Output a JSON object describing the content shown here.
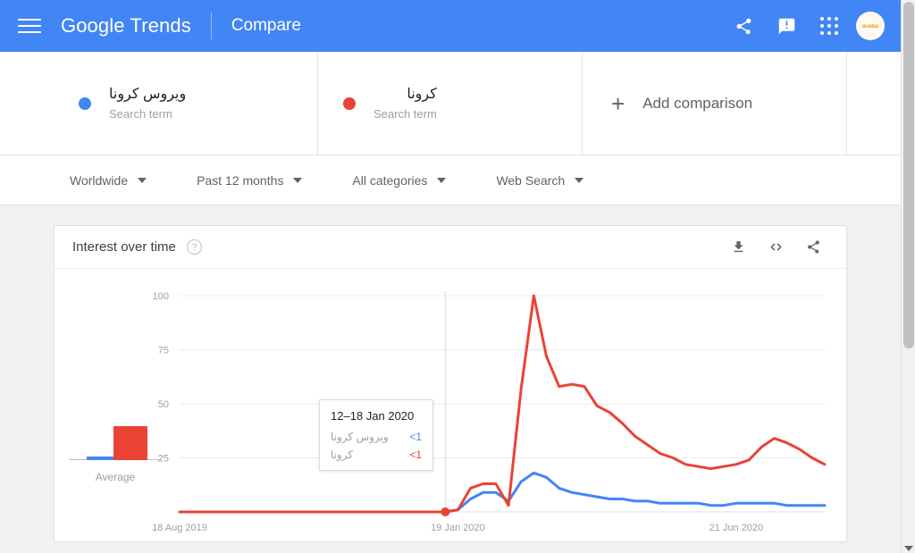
{
  "header": {
    "menu_icon": "hamburger-icon",
    "brand_google": "Google",
    "brand_trends": "Trends",
    "title": "Compare",
    "share_icon": "share-icon",
    "feedback_icon": "feedback-icon",
    "apps_icon": "apps-grid-icon",
    "avatar_text": "avatar"
  },
  "terms": [
    {
      "label": "ویروس کرونا",
      "type": "Search term",
      "color": "#4285f4"
    },
    {
      "label": "کرونا",
      "type": "Search term",
      "color": "#ea4335"
    }
  ],
  "add_comparison": {
    "plus": "+",
    "label": "Add comparison"
  },
  "filters": [
    {
      "label": "Worldwide"
    },
    {
      "label": "Past 12 months"
    },
    {
      "label": "All categories"
    },
    {
      "label": "Web Search"
    }
  ],
  "card": {
    "title": "Interest over time",
    "help_icon": "help-icon",
    "download_icon": "download-icon",
    "embed_icon": "embed-code-icon",
    "share_icon": "share-icon"
  },
  "tooltip": {
    "date": "12–18 Jan 2020",
    "rows": [
      {
        "term": "ویروس کرونا",
        "value": "<1",
        "color": "#4285f4"
      },
      {
        "term": "کرونا",
        "value": "<1",
        "color": "#ea4335"
      }
    ]
  },
  "average": {
    "label": "Average",
    "blue_value": 2,
    "red_value": 18
  },
  "colors": {
    "header_blue": "#4285f4",
    "series_blue": "#4285f4",
    "series_red": "#ea4335",
    "page_bg": "#f1f1f1",
    "text_primary": "#202124",
    "text_secondary": "#5f6368",
    "text_muted": "#9aa0a6"
  },
  "chart_data": {
    "type": "line",
    "title": "Interest over time",
    "xlabel": "",
    "ylabel": "",
    "ylim": [
      0,
      100
    ],
    "grid": true,
    "legend_position": "top",
    "y_ticks": [
      25,
      50,
      75,
      100
    ],
    "x_tick_labels": [
      "18 Aug 2019",
      "19 Jan 2020",
      "21 Jun 2020"
    ],
    "x_tick_indices": [
      0,
      22,
      44
    ],
    "highlight_index": 21,
    "highlight_label": "12–18 Jan 2020",
    "x": [
      "18 Aug 2019",
      "25 Aug 2019",
      "1 Sep 2019",
      "8 Sep 2019",
      "15 Sep 2019",
      "22 Sep 2019",
      "29 Sep 2019",
      "6 Oct 2019",
      "13 Oct 2019",
      "20 Oct 2019",
      "27 Oct 2019",
      "3 Nov 2019",
      "10 Nov 2019",
      "17 Nov 2019",
      "24 Nov 2019",
      "1 Dec 2019",
      "8 Dec 2019",
      "15 Dec 2019",
      "22 Dec 2019",
      "29 Dec 2019",
      "5 Jan 2020",
      "12 Jan 2020",
      "19 Jan 2020",
      "26 Jan 2020",
      "2 Feb 2020",
      "9 Feb 2020",
      "16 Feb 2020",
      "23 Feb 2020",
      "1 Mar 2020",
      "8 Mar 2020",
      "15 Mar 2020",
      "22 Mar 2020",
      "29 Mar 2020",
      "5 Apr 2020",
      "12 Apr 2020",
      "19 Apr 2020",
      "26 Apr 2020",
      "3 May 2020",
      "10 May 2020",
      "17 May 2020",
      "24 May 2020",
      "31 May 2020",
      "7 Jun 2020",
      "14 Jun 2020",
      "21 Jun 2020",
      "28 Jun 2020",
      "5 Jul 2020",
      "12 Jul 2020",
      "19 Jul 2020",
      "26 Jul 2020",
      "2 Aug 2020",
      "9 Aug 2020"
    ],
    "series": [
      {
        "name": "ویروس کرونا",
        "color": "#4285f4",
        "values": [
          0,
          0,
          0,
          0,
          0,
          0,
          0,
          0,
          0,
          0,
          0,
          0,
          0,
          0,
          0,
          0,
          0,
          0,
          0,
          0,
          0,
          0,
          1,
          6,
          9,
          9,
          5,
          14,
          18,
          16,
          11,
          9,
          8,
          7,
          6,
          6,
          5,
          5,
          4,
          4,
          4,
          4,
          3,
          3,
          4,
          4,
          4,
          4,
          3,
          3,
          3,
          3
        ]
      },
      {
        "name": "کرونا",
        "color": "#ea4335",
        "values": [
          0,
          0,
          0,
          0,
          0,
          0,
          0,
          0,
          0,
          0,
          0,
          0,
          0,
          0,
          0,
          0,
          0,
          0,
          0,
          0,
          0,
          0,
          1,
          11,
          13,
          13,
          3,
          57,
          100,
          72,
          58,
          59,
          58,
          49,
          46,
          41,
          35,
          31,
          27,
          25,
          22,
          21,
          20,
          21,
          22,
          24,
          30,
          34,
          32,
          29,
          25,
          22
        ]
      }
    ]
  }
}
